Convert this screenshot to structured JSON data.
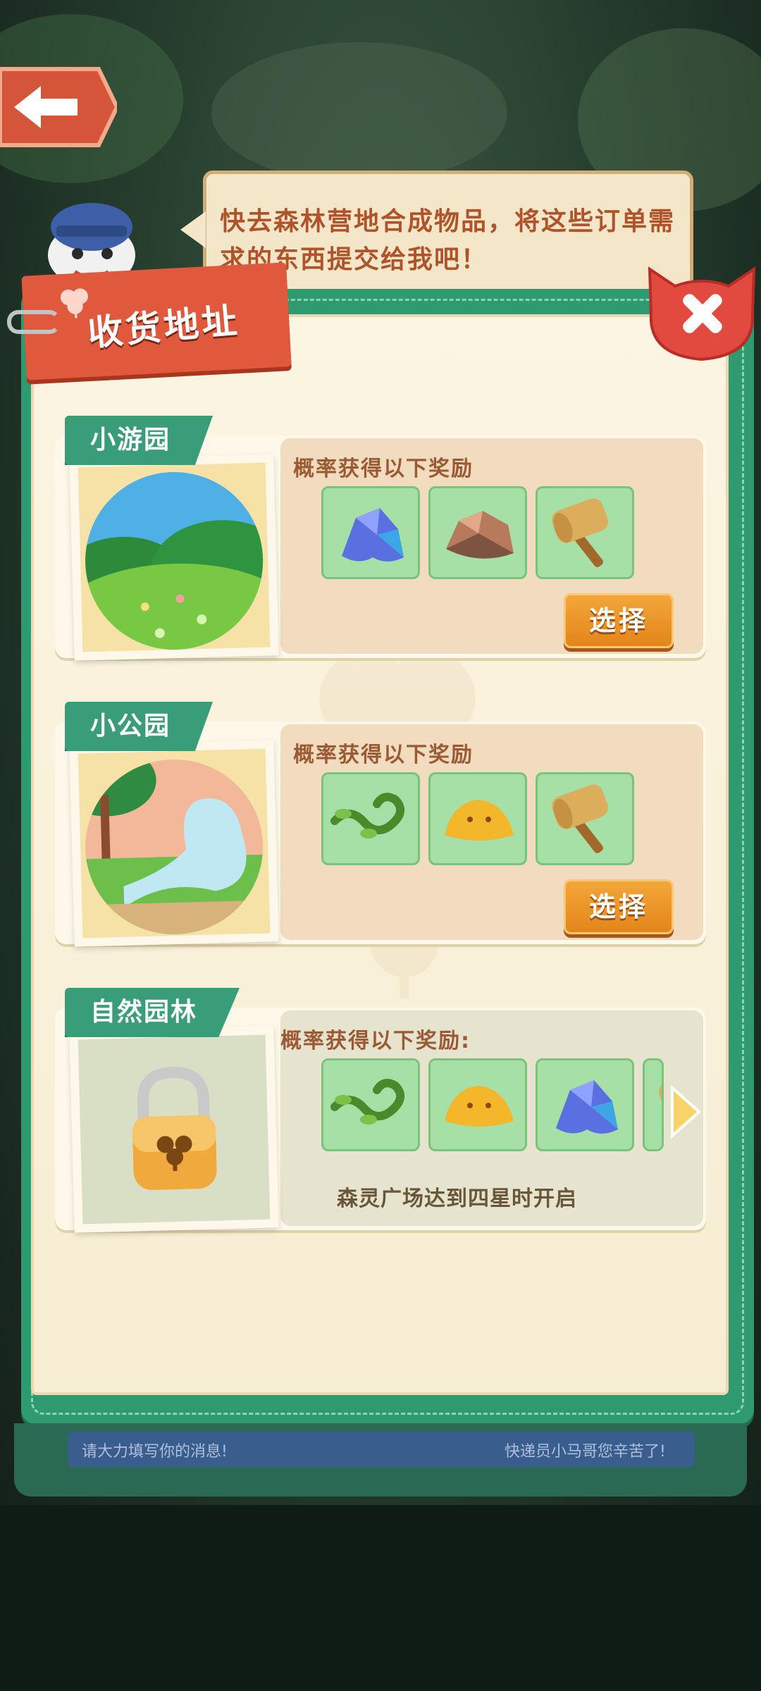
{
  "dialog": {
    "speech": "快去森林营地合成物品，将这些订单需求的东西提交给我吧！",
    "header_title": "收货地址"
  },
  "cards": [
    {
      "name": "小游园",
      "reward_title": "概率获得以下奖励",
      "rewards": [
        "blue-crystal-icon",
        "rock-icon",
        "wooden-hammer-icon"
      ],
      "button": "选择",
      "locked": false
    },
    {
      "name": "小公园",
      "reward_title": "概率获得以下奖励",
      "rewards": [
        "vine-icon",
        "yellow-slime-icon",
        "wooden-hammer-icon"
      ],
      "button": "选择",
      "locked": false
    },
    {
      "name": "自然园林",
      "reward_title": "概率获得以下奖励:",
      "rewards": [
        "vine-icon",
        "yellow-slime-icon",
        "blue-crystal-icon",
        "wooden-hammer-icon"
      ],
      "lock_note": "森灵广场达到四星时开启",
      "locked": true
    }
  ],
  "bottom_bar": {
    "left_text": "请大力填写你的消息!",
    "right_text": "快递员小马哥您辛苦了!"
  },
  "colors": {
    "panel_green": "#2f9a6f",
    "header_red": "#e0593d",
    "button_orange": "#e38318",
    "slot_green": "#a6e0a6"
  }
}
